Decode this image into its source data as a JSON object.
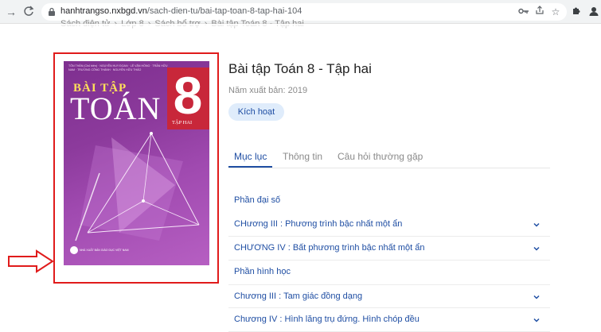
{
  "browser": {
    "url_host": "hanhtrangso.nxbgd.vn",
    "url_path": "/sach-dien-tu/bai-tap-toan-8-tap-hai-104"
  },
  "breadcrumb": [
    "Sách điện tử",
    "Lớp 8",
    "Sách bổ trợ",
    "Bài tập Toán 8 - Tập hai"
  ],
  "cover": {
    "authors": "TÔN THÂN (Chủ biên) · NGUYỄN HUY ĐOAN · LÊ VĂN HỒNG · TRẦN HỮU NAM · TRƯƠNG CÔNG THÀNH · NGUYỄN HỮU THẢO",
    "title_line1": "BÀI TẬP",
    "title_line2": "TOÁN",
    "grade": "8",
    "volume": "TẬP HAI",
    "publisher": "NHÀ XUẤT BẢN GIÁO DỤC VIỆT NAM"
  },
  "book": {
    "title": "Bài tập Toán 8 - Tập hai",
    "year": "Năm xuất bản: 2019",
    "activate_label": "Kích hoạt"
  },
  "tabs": [
    {
      "label": "Mục lục",
      "active": true
    },
    {
      "label": "Thông tin",
      "active": false
    },
    {
      "label": "Câu hỏi thường gặp",
      "active": false
    }
  ],
  "toc": [
    {
      "label": "Phần đại số",
      "type": "section"
    },
    {
      "label": "CHương III :  Phương trình bậc nhất một ẩn",
      "type": "chapter"
    },
    {
      "label": "CHƯƠNG IV :  Bất phương trình bậc nhất một ẩn",
      "type": "chapter"
    },
    {
      "label": "Phần hình học",
      "type": "section"
    },
    {
      "label": "Chương III :  Tam giác đồng dạng",
      "type": "chapter"
    },
    {
      "label": "Chương IV :  Hình lăng trụ đứng. Hình chóp đều",
      "type": "chapter"
    }
  ],
  "colors": {
    "accent": "#1f4ea3",
    "highlight_frame": "#e01b1b"
  }
}
